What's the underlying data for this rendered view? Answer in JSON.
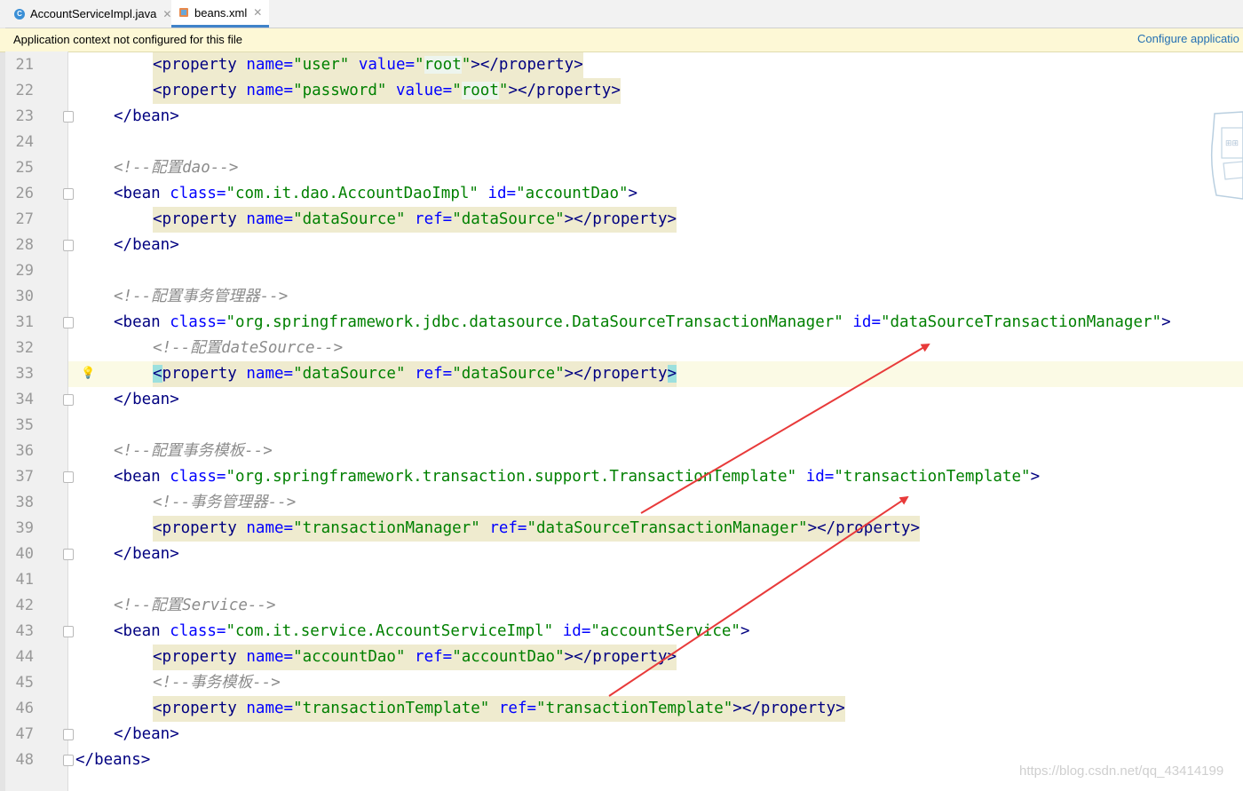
{
  "tabs": [
    {
      "label": "AccountServiceImpl.java",
      "icon": "java-class-icon"
    },
    {
      "label": "beans.xml",
      "icon": "xml-file-icon"
    }
  ],
  "banner": {
    "message": "Application context not configured for this file",
    "link": "Configure applicatio"
  },
  "colors": {
    "tag": "#000080",
    "attr": "#0000ff",
    "value": "#008000",
    "comment": "#8c8c8c",
    "arrow": "#e83a3a"
  },
  "lines": [
    {
      "num": "21",
      "indent": 2,
      "tokens": [
        [
          "t",
          "<property"
        ],
        [
          "p",
          " "
        ],
        [
          "a",
          "name="
        ],
        [
          "v",
          "\"user\""
        ],
        [
          "p",
          " "
        ],
        [
          "a",
          "value="
        ],
        [
          "v",
          "\""
        ],
        [
          "vh",
          "root"
        ],
        [
          "v",
          "\""
        ],
        [
          "t",
          "></property>"
        ]
      ],
      "hl": true
    },
    {
      "num": "22",
      "indent": 2,
      "tokens": [
        [
          "t",
          "<property"
        ],
        [
          "p",
          " "
        ],
        [
          "a",
          "name="
        ],
        [
          "v",
          "\"password\""
        ],
        [
          "p",
          " "
        ],
        [
          "a",
          "value="
        ],
        [
          "v",
          "\""
        ],
        [
          "vh",
          "root"
        ],
        [
          "v",
          "\""
        ],
        [
          "t",
          "></property>"
        ]
      ],
      "hl": true
    },
    {
      "num": "23",
      "indent": 1,
      "fold": true,
      "tokens": [
        [
          "t",
          "</bean>"
        ]
      ]
    },
    {
      "num": "24",
      "indent": 0,
      "tokens": []
    },
    {
      "num": "25",
      "indent": 1,
      "tokens": [
        [
          "c",
          "<!--配置dao-->"
        ]
      ]
    },
    {
      "num": "26",
      "indent": 1,
      "fold": true,
      "tokens": [
        [
          "t",
          "<bean"
        ],
        [
          "p",
          " "
        ],
        [
          "a",
          "class="
        ],
        [
          "v",
          "\"com.it.dao.AccountDaoImpl\""
        ],
        [
          "p",
          " "
        ],
        [
          "a",
          "id="
        ],
        [
          "v",
          "\"accountDao\""
        ],
        [
          "t",
          ">"
        ]
      ]
    },
    {
      "num": "27",
      "indent": 2,
      "tokens": [
        [
          "t",
          "<property"
        ],
        [
          "p",
          " "
        ],
        [
          "a",
          "name="
        ],
        [
          "v",
          "\"dataSource\""
        ],
        [
          "p",
          " "
        ],
        [
          "a",
          "ref="
        ],
        [
          "v",
          "\"dataSource\""
        ],
        [
          "t",
          "></property>"
        ]
      ],
      "hl": true
    },
    {
      "num": "28",
      "indent": 1,
      "fold": true,
      "tokens": [
        [
          "t",
          "</bean>"
        ]
      ]
    },
    {
      "num": "29",
      "indent": 0,
      "tokens": []
    },
    {
      "num": "30",
      "indent": 1,
      "tokens": [
        [
          "c",
          "<!--配置事务管理器-->"
        ]
      ]
    },
    {
      "num": "31",
      "indent": 1,
      "fold": true,
      "tokens": [
        [
          "t",
          "<bean"
        ],
        [
          "p",
          " "
        ],
        [
          "a",
          "class="
        ],
        [
          "v",
          "\"org.springframework.jdbc.datasource.DataSourceTransactionManager\""
        ],
        [
          "p",
          " "
        ],
        [
          "a",
          "id="
        ],
        [
          "v",
          "\"dataSourceTransactionManager\""
        ],
        [
          "t",
          ">"
        ]
      ]
    },
    {
      "num": "32",
      "indent": 2,
      "tokens": [
        [
          "c",
          "<!--配置dateSource-->"
        ]
      ]
    },
    {
      "num": "33",
      "indent": 2,
      "current": true,
      "bulb": true,
      "tokens": [
        [
          "t2",
          "<"
        ],
        [
          "t",
          "property"
        ],
        [
          "p",
          " "
        ],
        [
          "a",
          "name="
        ],
        [
          "v",
          "\"dataSource\""
        ],
        [
          "p",
          " "
        ],
        [
          "a",
          "ref="
        ],
        [
          "v",
          "\"dataSource\""
        ],
        [
          "t",
          "></property"
        ],
        [
          "t2",
          ">"
        ]
      ],
      "hl": true
    },
    {
      "num": "34",
      "indent": 1,
      "fold": true,
      "tokens": [
        [
          "t",
          "</bean>"
        ]
      ]
    },
    {
      "num": "35",
      "indent": 0,
      "tokens": []
    },
    {
      "num": "36",
      "indent": 1,
      "tokens": [
        [
          "c",
          "<!--配置事务模板-->"
        ]
      ]
    },
    {
      "num": "37",
      "indent": 1,
      "fold": true,
      "tokens": [
        [
          "t",
          "<bean"
        ],
        [
          "p",
          " "
        ],
        [
          "a",
          "class="
        ],
        [
          "v",
          "\"org.springframework.transaction.support.TransactionTemplate\""
        ],
        [
          "p",
          " "
        ],
        [
          "a",
          "id="
        ],
        [
          "v",
          "\"transactionTemplate\""
        ],
        [
          "t",
          ">"
        ]
      ]
    },
    {
      "num": "38",
      "indent": 2,
      "tokens": [
        [
          "c",
          "<!--事务管理器-->"
        ]
      ]
    },
    {
      "num": "39",
      "indent": 2,
      "tokens": [
        [
          "t",
          "<property"
        ],
        [
          "p",
          " "
        ],
        [
          "a",
          "name="
        ],
        [
          "v",
          "\"transactionManager\""
        ],
        [
          "p",
          " "
        ],
        [
          "a",
          "ref="
        ],
        [
          "v",
          "\"dataSourceTransactionManager\""
        ],
        [
          "t",
          "></property>"
        ]
      ],
      "hl": true
    },
    {
      "num": "40",
      "indent": 1,
      "fold": true,
      "tokens": [
        [
          "t",
          "</bean>"
        ]
      ]
    },
    {
      "num": "41",
      "indent": 0,
      "tokens": []
    },
    {
      "num": "42",
      "indent": 1,
      "tokens": [
        [
          "c",
          "<!--配置Service-->"
        ]
      ]
    },
    {
      "num": "43",
      "indent": 1,
      "fold": true,
      "tokens": [
        [
          "t",
          "<bean"
        ],
        [
          "p",
          " "
        ],
        [
          "a",
          "class="
        ],
        [
          "v",
          "\"com.it.service.AccountServiceImpl\""
        ],
        [
          "p",
          " "
        ],
        [
          "a",
          "id="
        ],
        [
          "v",
          "\"accountService\""
        ],
        [
          "t",
          ">"
        ]
      ]
    },
    {
      "num": "44",
      "indent": 2,
      "tokens": [
        [
          "t",
          "<property"
        ],
        [
          "p",
          " "
        ],
        [
          "a",
          "name="
        ],
        [
          "v",
          "\"accountDao\""
        ],
        [
          "p",
          " "
        ],
        [
          "a",
          "ref="
        ],
        [
          "v",
          "\"accountDao\""
        ],
        [
          "t",
          "></property>"
        ]
      ],
      "hl": true
    },
    {
      "num": "45",
      "indent": 2,
      "tokens": [
        [
          "c",
          "<!--事务模板-->"
        ]
      ]
    },
    {
      "num": "46",
      "indent": 2,
      "tokens": [
        [
          "t",
          "<property"
        ],
        [
          "p",
          " "
        ],
        [
          "a",
          "name="
        ],
        [
          "v",
          "\"transactionTemplate\""
        ],
        [
          "p",
          " "
        ],
        [
          "a",
          "ref="
        ],
        [
          "v",
          "\"transactionTemplate\""
        ],
        [
          "t",
          "></property>"
        ]
      ],
      "hl": true
    },
    {
      "num": "47",
      "indent": 1,
      "fold": true,
      "tokens": [
        [
          "t",
          "</bean>"
        ]
      ]
    },
    {
      "num": "48",
      "indent": 0,
      "fold": true,
      "tokens": [
        [
          "t",
          "</beans>"
        ]
      ]
    }
  ],
  "watermark": "https://blog.csdn.net/qq_43414199"
}
